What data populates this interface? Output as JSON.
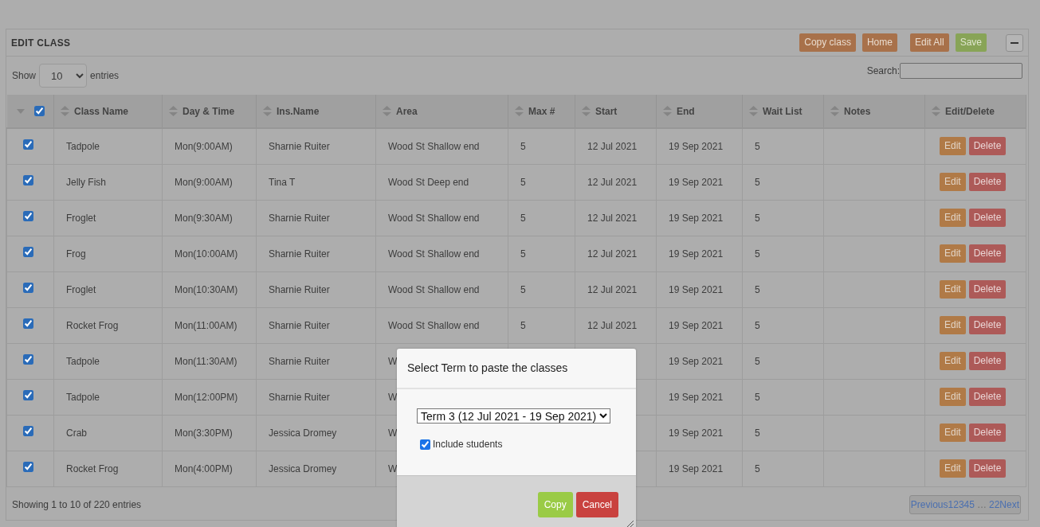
{
  "panel": {
    "title": "EDIT CLASS",
    "buttons": [
      {
        "label": "Copy class",
        "kind": "orange"
      },
      {
        "label": "Home",
        "kind": "orange"
      },
      {
        "label": "Edit All",
        "kind": "orange"
      },
      {
        "label": "Save",
        "kind": "green"
      }
    ]
  },
  "length": {
    "show_label": "Show",
    "value": "10",
    "entries_label": "entries"
  },
  "search": {
    "label": "Search:"
  },
  "table": {
    "select_all": true,
    "columns": [
      "Class Name",
      "Day & Time",
      "Ins.Name",
      "Area",
      "Max #",
      "Start",
      "End",
      "Wait List",
      "Notes",
      "Edit/Delete"
    ],
    "rows": [
      {
        "selected": true,
        "cells": [
          "Tadpole",
          "Mon(9:00AM)",
          "Sharnie Ruiter",
          "Wood St Shallow end",
          "5",
          "12 Jul 2021",
          "19 Sep 2021",
          "5",
          null
        ],
        "edit": "Edit",
        "delete": "Delete"
      },
      {
        "selected": true,
        "cells": [
          "Jelly Fish",
          "Mon(9:00AM)",
          "Tina T",
          "Wood St Deep end",
          "5",
          "12 Jul 2021",
          "19 Sep 2021",
          "5",
          null
        ],
        "edit": "Edit",
        "delete": "Delete"
      },
      {
        "selected": true,
        "cells": [
          "Froglet",
          "Mon(9:30AM)",
          "Sharnie Ruiter",
          "Wood St Shallow end",
          "5",
          "12 Jul 2021",
          "19 Sep 2021",
          "5",
          null
        ],
        "edit": "Edit",
        "delete": "Delete"
      },
      {
        "selected": true,
        "cells": [
          "Frog",
          "Mon(10:00AM)",
          "Sharnie Ruiter",
          "Wood St Shallow end",
          "5",
          "12 Jul 2021",
          "19 Sep 2021",
          "5",
          null
        ],
        "edit": "Edit",
        "delete": "Delete"
      },
      {
        "selected": true,
        "cells": [
          "Froglet",
          "Mon(10:30AM)",
          "Sharnie Ruiter",
          "Wood St Shallow end",
          "5",
          "12 Jul 2021",
          "19 Sep 2021",
          "5",
          null
        ],
        "edit": "Edit",
        "delete": "Delete"
      },
      {
        "selected": true,
        "cells": [
          "Rocket Frog",
          "Mon(11:00AM)",
          "Sharnie Ruiter",
          "Wood St Shallow end",
          "5",
          "12 Jul 2021",
          "19 Sep 2021",
          "5",
          null
        ],
        "edit": "Edit",
        "delete": "Delete"
      },
      {
        "selected": true,
        "cells": [
          "Tadpole",
          "Mon(11:30AM)",
          "Sharnie Ruiter",
          "W",
          null,
          null,
          "19 Sep 2021",
          "5",
          null
        ],
        "edit": "Edit",
        "delete": "Delete"
      },
      {
        "selected": true,
        "cells": [
          "Tadpole",
          "Mon(12:00PM)",
          "Sharnie Ruiter",
          "W",
          null,
          null,
          "19 Sep 2021",
          "5",
          null
        ],
        "edit": "Edit",
        "delete": "Delete"
      },
      {
        "selected": true,
        "cells": [
          "Crab",
          "Mon(3:30PM)",
          "Jessica Dromey",
          "W",
          null,
          null,
          "19 Sep 2021",
          "5",
          null
        ],
        "edit": "Edit",
        "delete": "Delete"
      },
      {
        "selected": true,
        "cells": [
          "Rocket Frog",
          "Mon(4:00PM)",
          "Jessica Dromey",
          "W",
          null,
          null,
          "19 Sep 2021",
          "5",
          null
        ],
        "edit": "Edit",
        "delete": "Delete"
      }
    ]
  },
  "info": "Showing 1 to 10 of 220 entries",
  "pagination": [
    {
      "label": "Previous",
      "kind": "link"
    },
    {
      "label": "1",
      "kind": "link"
    },
    {
      "label": "2",
      "kind": "link"
    },
    {
      "label": "3",
      "kind": "link"
    },
    {
      "label": "4",
      "kind": "link"
    },
    {
      "label": "5",
      "kind": "link"
    },
    {
      "label": "…",
      "kind": "ellipsis"
    },
    {
      "label": "22",
      "kind": "link"
    },
    {
      "label": "Next",
      "kind": "link"
    }
  ],
  "modal": {
    "title": "Select Term to paste the classes",
    "term": "Term 3 (12 Jul 2021 - 19 Sep 2021)",
    "include_students": {
      "label": "Include students",
      "checked": true
    },
    "buttons": [
      {
        "label": "Copy",
        "kind": "green"
      },
      {
        "label": "Cancel",
        "kind": "red"
      }
    ]
  }
}
